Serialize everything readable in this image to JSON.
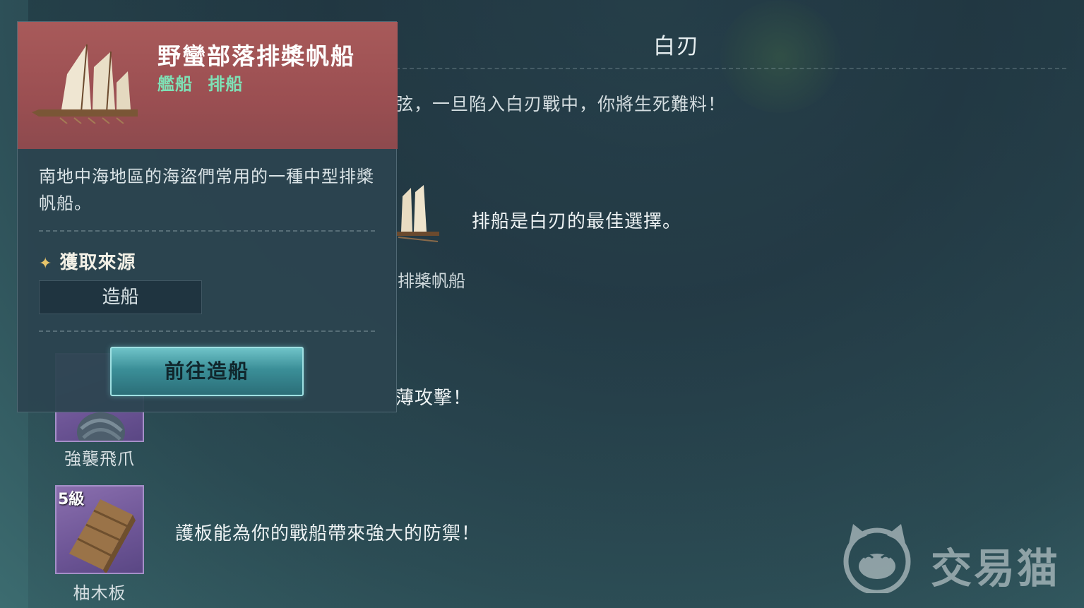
{
  "background": {
    "title": "白刃",
    "intro_text": "弦，一旦陷入白刃戰中，你將生死難料！",
    "ship_tip": "排船是白刃的最佳選擇。",
    "ship_name_partial": "排槳帆船",
    "hook_tip_partial": "薄攻擊！",
    "items": [
      {
        "name": "強襲飛爪",
        "icon": "grappling-hook-icon"
      },
      {
        "name": "柚木板",
        "level": "5級",
        "icon": "wooden-plank-icon",
        "tip": "護板能為你的戰船帶來強大的防禦！"
      }
    ]
  },
  "popup": {
    "title": "野蠻部落排槳帆船",
    "tags": [
      "艦船",
      "排船"
    ],
    "description": "南地中海地區的海盜們常用的一種中型排槳帆船。",
    "source_heading": "獲取來源",
    "source_item": "造船",
    "action_button": "前往造船",
    "header_color": "#a85a5a",
    "tag_color": "#7fe0b5"
  },
  "watermark": {
    "text": "交易猫",
    "icon": "cat-face-icon"
  }
}
